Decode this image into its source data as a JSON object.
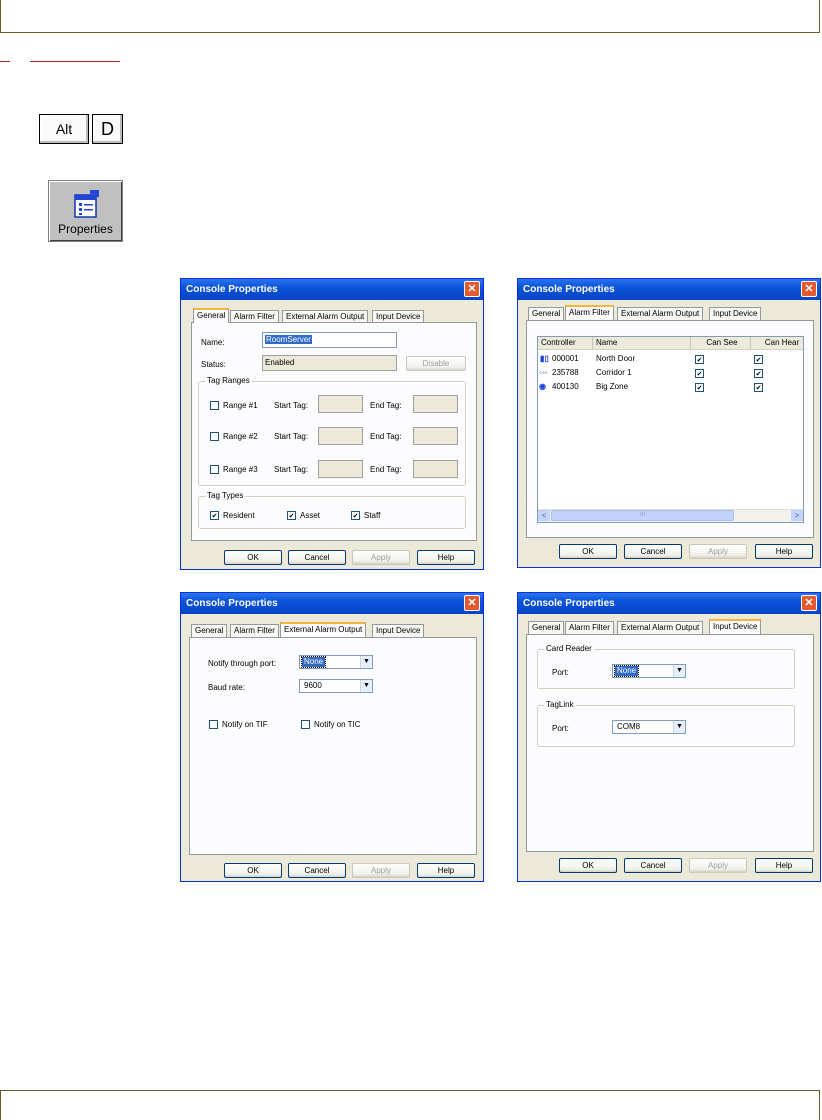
{
  "keys": {
    "alt": "Alt",
    "d": "D"
  },
  "toolbar": {
    "properties_label": "Properties",
    "icon": "properties-icon"
  },
  "dialogs": {
    "title": "Console Properties",
    "close_glyph": "✕",
    "tabs": [
      "General",
      "Alarm Filter",
      "External Alarm Output",
      "Input Device"
    ],
    "buttons": {
      "ok": "OK",
      "cancel": "Cancel",
      "apply": "Apply",
      "help": "Help"
    }
  },
  "general": {
    "name_label": "Name:",
    "name_value": "RoomServer",
    "status_label": "Status:",
    "status_value": "Enabled",
    "disable_label": "Disable",
    "tag_ranges_label": "Tag Ranges",
    "ranges": [
      {
        "label": "Range #1",
        "start": "Start Tag:",
        "end": "End Tag:"
      },
      {
        "label": "Range #2",
        "start": "Start Tag:",
        "end": "End Tag:"
      },
      {
        "label": "Range #3",
        "start": "Start Tag:",
        "end": "End Tag:"
      }
    ],
    "tag_types_label": "Tag Types",
    "tag_types": [
      {
        "label": "Resident",
        "checked": true
      },
      {
        "label": "Asset",
        "checked": true
      },
      {
        "label": "Staff",
        "checked": true
      }
    ]
  },
  "alarm_filter": {
    "columns": [
      "Controller",
      "Name",
      "Can See",
      "Can Hear"
    ],
    "rows": [
      {
        "controller": "000001",
        "name": "North Door",
        "can_see": true,
        "can_hear": true,
        "icon": "door-controller-icon"
      },
      {
        "controller": "235788",
        "name": "Corridor 1",
        "can_see": true,
        "can_hear": true,
        "icon": "corridor-controller-icon"
      },
      {
        "controller": "400130",
        "name": "Big Zone",
        "can_see": true,
        "can_hear": true,
        "icon": "zone-controller-icon"
      }
    ],
    "scroll_left": "<",
    "scroll_right": ">",
    "scroll_grip": "III"
  },
  "external_alarm_output": {
    "notify_port_label": "Notify through port:",
    "notify_port_value": "None",
    "baud_label": "Baud rate:",
    "baud_value": "9600",
    "notify_tif": "Notify on TIF",
    "notify_tic": "Notify on TIC"
  },
  "input_device": {
    "card_reader_label": "Card Reader",
    "card_port_label": "Port:",
    "card_port_value": "None",
    "taglink_label": "TagLink",
    "taglink_port_label": "Port:",
    "taglink_port_value": "COM8"
  },
  "combo_arrow": "▼"
}
